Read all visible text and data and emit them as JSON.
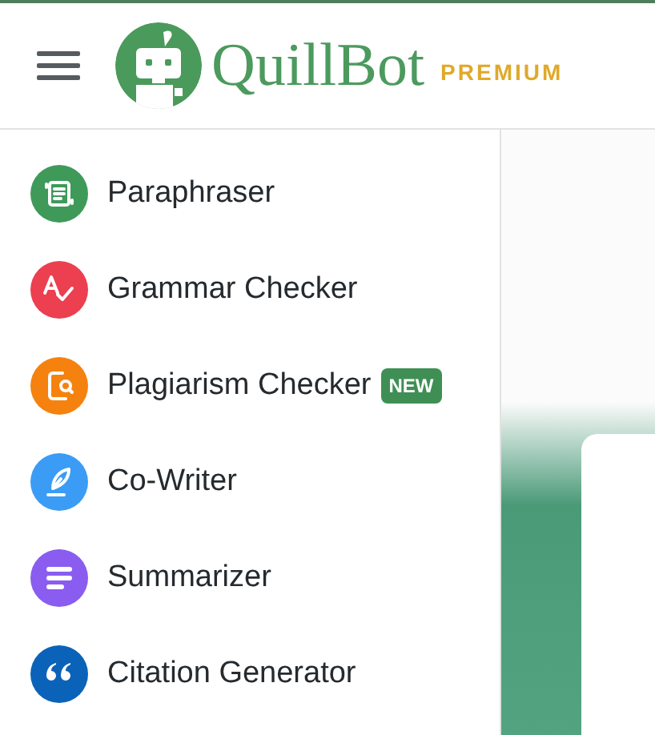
{
  "header": {
    "brand": "QuillBot",
    "tier": "PREMIUM"
  },
  "sidebar": {
    "items": [
      {
        "label": "Paraphraser",
        "kind": "paraphrase",
        "color": "#3f9a5a"
      },
      {
        "label": "Grammar Checker",
        "kind": "grammar",
        "color": "#ec3f4f"
      },
      {
        "label": "Plagiarism Checker",
        "kind": "plagiarism",
        "color": "#f5820f",
        "badge": "NEW"
      },
      {
        "label": "Co-Writer",
        "kind": "cowriter",
        "color": "#3b9cf5"
      },
      {
        "label": "Summarizer",
        "kind": "summary",
        "color": "#8a5cf0"
      },
      {
        "label": "Citation Generator",
        "kind": "citation",
        "color": "#0a63b8"
      }
    ]
  }
}
